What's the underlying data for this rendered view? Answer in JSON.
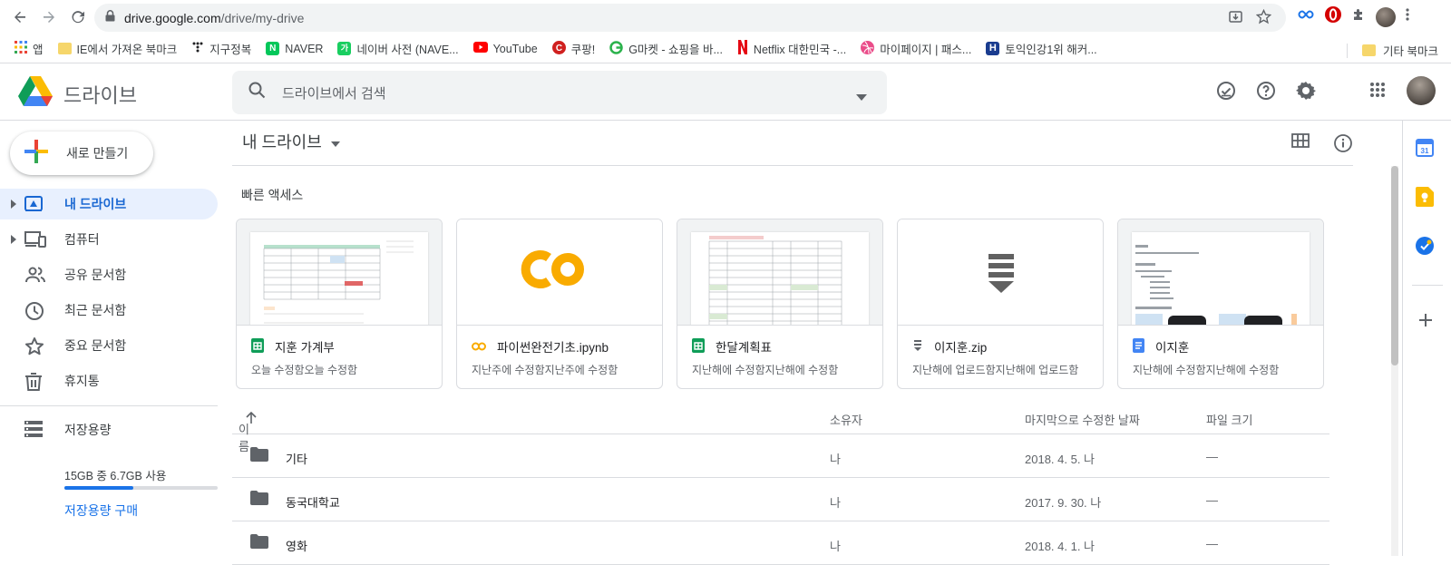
{
  "browser": {
    "url_host": "drive.google.com",
    "url_path": "/drive/my-drive",
    "bookmarks": [
      {
        "label": "앱",
        "icon": "apps-grid-icon",
        "color": "#4285f4"
      },
      {
        "label": "IE에서 가져온 북마크",
        "icon": "folder-icon",
        "color": "#f6d66b"
      },
      {
        "label": "지구정복",
        "icon": "dots-icon",
        "color": "#202124"
      },
      {
        "label": "NAVER",
        "icon": "naver-icon",
        "color": "#03c75a"
      },
      {
        "label": "네이버 사전 (NAVE...",
        "icon": "naver-dict-icon",
        "color": "#19ce60"
      },
      {
        "label": "YouTube",
        "icon": "youtube-icon",
        "color": "#ff0000"
      },
      {
        "label": "쿠팡!",
        "icon": "coupang-icon",
        "color": "#d0201f"
      },
      {
        "label": "G마켓 - 쇼핑을 바...",
        "icon": "gmarket-icon",
        "color": "#2bb24c"
      },
      {
        "label": "Netflix 대한민국 -...",
        "icon": "netflix-icon",
        "color": "#e50914"
      },
      {
        "label": "마이페이지 | 패스...",
        "icon": "dribbble-icon",
        "color": "#ea4c89"
      },
      {
        "label": "토익인강1위 해커...",
        "icon": "hackers-icon",
        "color": "#1a3c8f"
      }
    ],
    "other_bookmarks": "기타 북마크"
  },
  "header": {
    "app_name": "드라이브",
    "search_placeholder": "드라이브에서 검색"
  },
  "sidebar": {
    "new_label": "새로 만들기",
    "items": [
      {
        "label": "내 드라이브",
        "icon": "my-drive-icon"
      },
      {
        "label": "컴퓨터",
        "icon": "computers-icon"
      },
      {
        "label": "공유 문서함",
        "icon": "shared-icon"
      },
      {
        "label": "최근 문서함",
        "icon": "clock-icon"
      },
      {
        "label": "중요 문서함",
        "icon": "star-icon"
      },
      {
        "label": "휴지통",
        "icon": "trash-icon"
      }
    ],
    "storage_label": "저장용량",
    "storage_usage": "15GB 중 6.7GB 사용",
    "storage_used_fraction": 0.45,
    "buy_storage": "저장용량 구매"
  },
  "main": {
    "title": "내 드라이브",
    "quick_access_label": "빠른 액세스",
    "quick_access": [
      {
        "name": "지훈 가계부",
        "sub": "오늘 수정함오늘 수정함",
        "icon": "sheets-icon",
        "color": "#0f9d58"
      },
      {
        "name": "파이썬완전기초.ipynb",
        "sub": "지난주에 수정함지난주에 수정함",
        "icon": "colab-icon",
        "color": "#f9ab00"
      },
      {
        "name": "한달계획표",
        "sub": "지난해에 수정함지난해에 수정함",
        "icon": "sheets-icon",
        "color": "#0f9d58"
      },
      {
        "name": "이지훈.zip",
        "sub": "지난해에 업로드함지난해에 업로드함",
        "icon": "zip-icon",
        "color": "#5f6368"
      },
      {
        "name": "이지훈",
        "sub": "지난해에 수정함지난해에 수정함",
        "icon": "docs-icon",
        "color": "#4285f4"
      }
    ],
    "columns": {
      "name": "이름",
      "owner": "소유자",
      "modified": "마지막으로 수정한 날짜",
      "size": "파일 크기"
    },
    "files": [
      {
        "name": "기타",
        "owner": "나",
        "modified": "2018. 4. 5. 나",
        "size": "—"
      },
      {
        "name": "동국대학교",
        "owner": "나",
        "modified": "2017. 9. 30. 나",
        "size": "—"
      },
      {
        "name": "영화",
        "owner": "나",
        "modified": "2018. 4. 1. 나",
        "size": "—"
      }
    ]
  }
}
